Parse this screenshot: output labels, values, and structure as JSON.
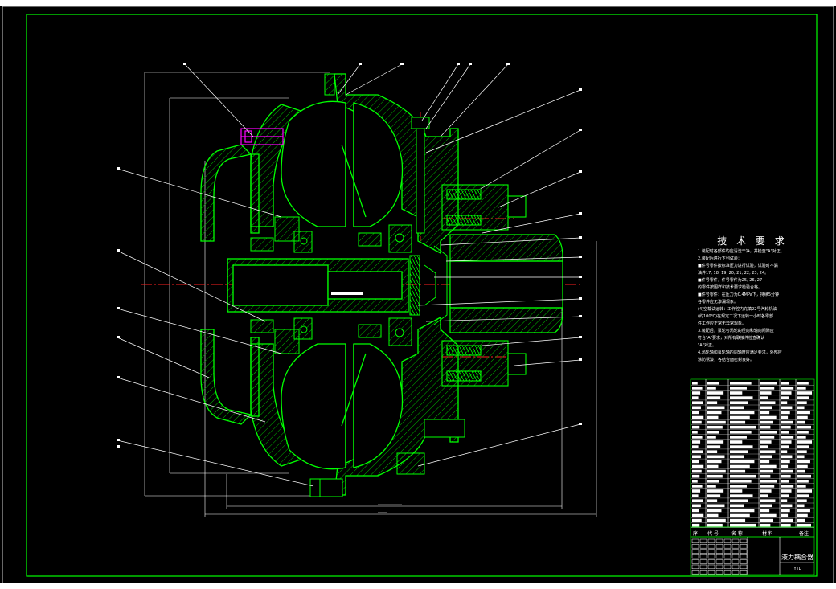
{
  "title_block": {
    "drawing_name": "液力耦合器",
    "drawing_code": "YTL"
  },
  "technical_requirements": {
    "title": "技 术 要 求",
    "notes": [
      "1.装配时各部件均应清洗干净，并检查\"A\"对正。",
      "2.装配后进行下列试验：",
      "  ■件号零件按标准压力进行试验，试验时不漏",
      "  油件17, 18, 19, 20, 21, 22, 23, 24。",
      "  ■件号零件，件号零件为25, 26, 27",
      "  的零件按图样和技术要求检验合格。",
      "  ■件号零件：在压力为0.4MPa下，持续5分钟",
      "  各零件应无渗漏现象。",
      "  (4)空载试运转：工作腔内充填22号汽轮机油",
      "  (约100℃)在规定工况下运转一小时各零部",
      "  件工作应正常无异常现象。",
      "3.装配后，泵轮与涡轮的径向和轴向间隙应",
      "  符合\"A\"要求，对所有联接件检查确认",
      "  \"A\"对正。",
      "4.涡轮轴和泵轮轴的同轴度应满足要求，外部应",
      "  涂防锈漆，各结合面密封良好。"
    ]
  },
  "bom_header": [
    "序",
    "代    号",
    "名    称",
    "材    料",
    "备注"
  ],
  "colors": {
    "background": "#000000",
    "frame": "#00ff00",
    "outline": "#00ff00",
    "hatch": "#00c800",
    "leader": "#ffffff",
    "centerline": "#ff2020",
    "bolt": "#ff00ff"
  }
}
